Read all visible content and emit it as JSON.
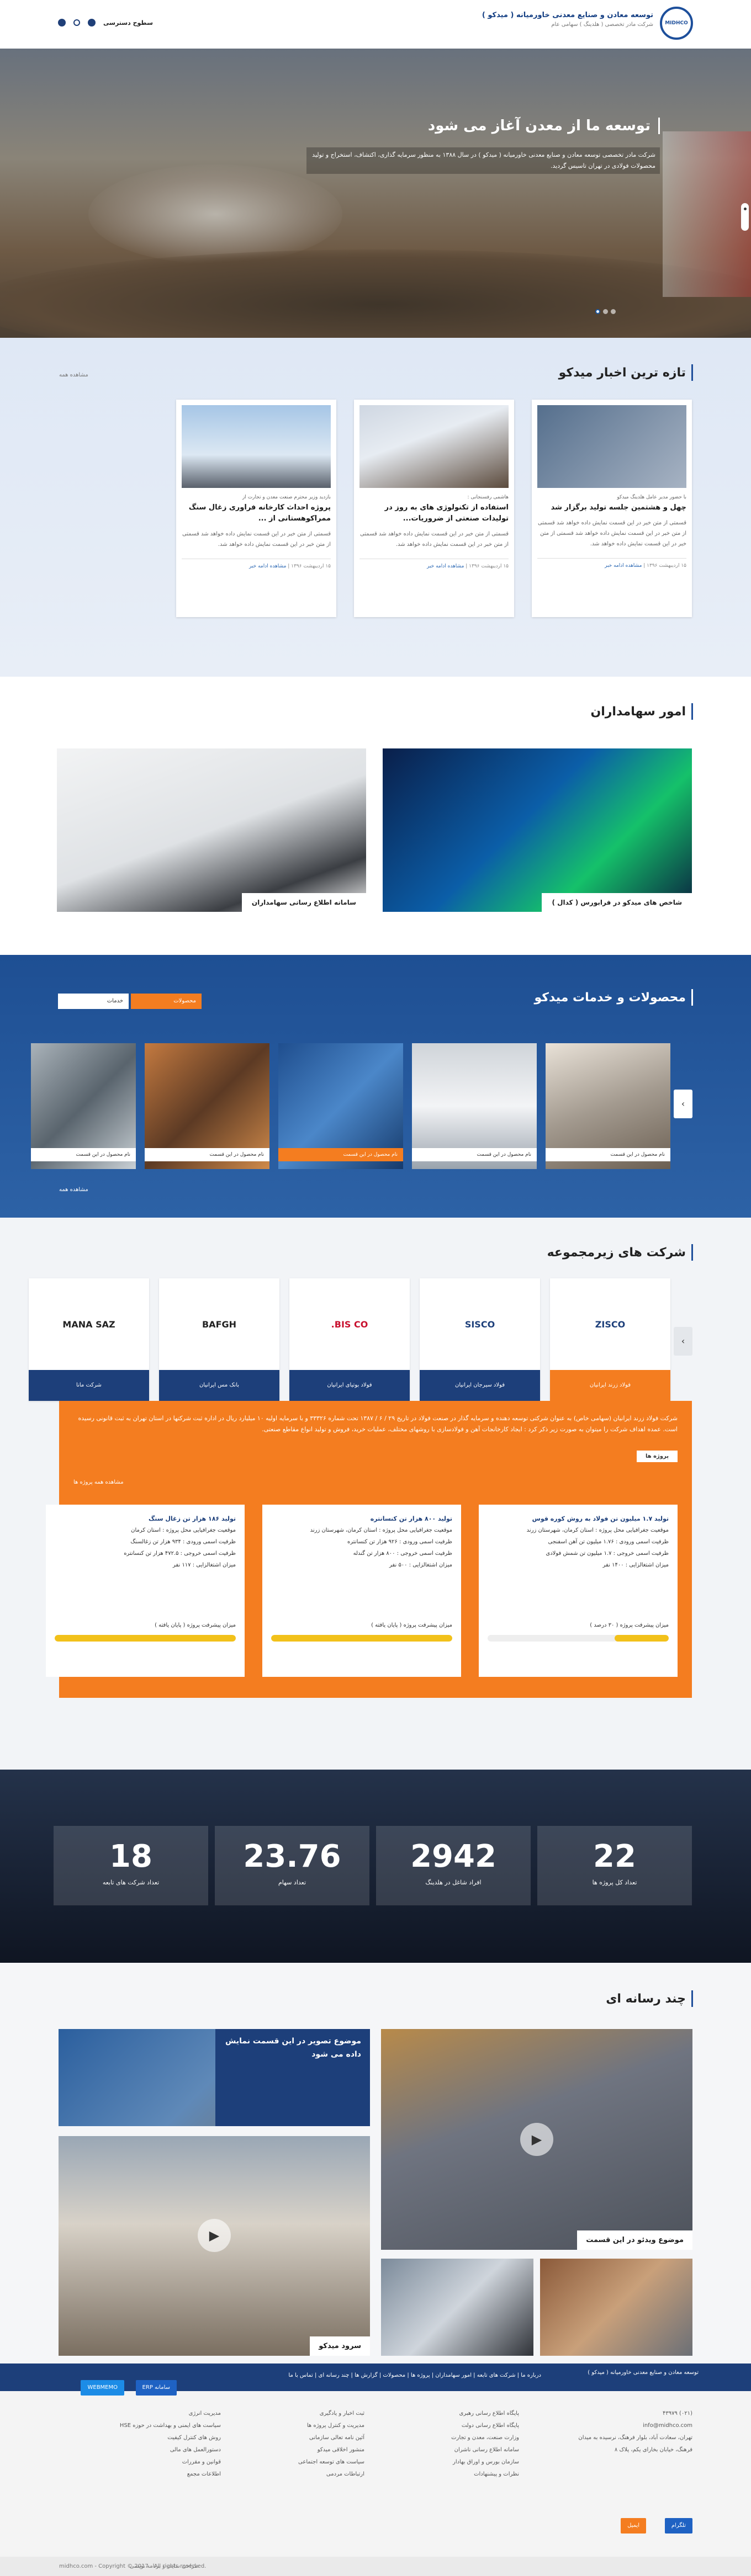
{
  "header": {
    "logo_text": "MIDHCO",
    "title": "توسعه معادن و صنایع معدنی خاورمیانه ( میدکو )",
    "subtitle": "شرکت مادر تخصصی ( هلدینگ ) سهامی عام",
    "access_level": "سطوح دسترسی",
    "icons": [
      "globe-icon",
      "search-icon",
      "user-icon"
    ]
  },
  "hero": {
    "title": "توسعه ما از معدن آغاز می شود",
    "text": "شرکت مادر تخصصی توسعه معادن و صنایع معدنی خاورمیانه ( میدکو ) در سال ۱۳۸۸ به منظور سرمایه گذاری، اکتشاف، استخراج و تولید محصولات فولادی در تهران تاسیس گردید."
  },
  "news": {
    "title": "تازه ترین اخبار میدکو",
    "more": "مشاهده همه",
    "items": [
      {
        "meta": "با حضور مدیر عامل هلدینگ میدکو",
        "title": "چهل و هشتمین جلسه تولید برگزار شد",
        "text": "قسمتی از متن خبر در این قسمت نمایش داده خواهد شد قسمتی از متن خبر در این قسمت نمایش داده خواهد شد قسمتی از متن خبر در این قسمت نمایش داده خواهد شد.",
        "date": "۱۵ اردیبهشت ۱۳۹۶",
        "more": "مشاهده ادامه خبر"
      },
      {
        "meta": "هاشمی رفسنجانی :",
        "title": "استفاده از تکنولوژی های به روز در تولیدات صنعتی از ضروریات...",
        "text": "قسمتی از متن خبر در این قسمت نمایش داده خواهد شد قسمتی از متن خبر در این قسمت نمایش داده خواهد شد.",
        "date": "۱۵ اردیبهشت ۱۳۹۶",
        "more": "مشاهده ادامه خبر"
      },
      {
        "meta": "بازدید وزیر محترم صنعت معدن و تجارت از",
        "title": "پروژه احداث کارخانه فراوری زغال سنگ ممراکوهستانی از ...",
        "text": "قسمتی از متن خبر در این قسمت نمایش داده خواهد شد قسمتی از متن خبر در این قسمت نمایش داده خواهد شد.",
        "date": "۱۵ اردیبهشت ۱۳۹۶",
        "more": "مشاهده ادامه خبر"
      }
    ]
  },
  "shareholders": {
    "title": "امور سهامداران",
    "cards": [
      "شاخص های میدکو در فرابورس ( کدال )",
      "سامانه اطلاع رسانی سهامداران"
    ]
  },
  "products": {
    "title": "محصولات و خدمات میدکو",
    "filter_1": "محصولات",
    "filter_2": "خدمات",
    "more": "مشاهده همه",
    "items": [
      "نام محصول در این قسمت",
      "نام محصول در این قسمت",
      "نام محصول در این قسمت",
      "نام محصول در این قسمت",
      "نام محصول در این قسمت"
    ]
  },
  "subsidiaries": {
    "title": "شرکت های زیرمجموعه",
    "companies": [
      {
        "logo": "ZISCO",
        "name": "فولاد زرند ایرانیان"
      },
      {
        "logo": "SISCO",
        "name": "فولاد سیرجان ایرانیان"
      },
      {
        "logo": "BIS CO.",
        "name": "فولاد بوتیای ایرانیان"
      },
      {
        "logo": "BAFGH",
        "name": "بانک مس ایرانیان"
      },
      {
        "logo": "MANA SAZ",
        "name": "شرکت مانا"
      }
    ],
    "description": "شرکت فولاد زرند ایرانیان (سهامی خاص) به عنوان شرکتی توسعه دهنده و سرمایه گذار در صنعت فولاد در تاریخ ۲۹ / ۶ / ۱۳۸۷ تحت شماره ۳۳۳۲۶ و با سرمایه اولیه ۱۰ میلیارد ریال در اداره ثبت شرکتها در استان تهران به ثبت قانونی رسیده است. عمده اهداف شرکت را میتوان به صورت زیر ذکر کرد : ایجاد کارخانجات آهن و فولادسازی با روشهای مختلف، عملیات خرید، فروش و تولید انواع مقاطع صنعتی.",
    "projects_label": "پروژه ها",
    "projects_more": "مشاهده همه پروژه ها",
    "projects": [
      {
        "title": "تولید ۱.۷ میلیون تن فولاد به روش کوره قوس",
        "lines": [
          "موقعیت جغرافیایی محل پروژه : استان کرمان، شهرستان زرند",
          "ظرفیت اسمی ورودی : ۱.۷۶ میلیون تن آهن اسفنجی",
          "ظرفیت اسمی خروجی : ۱.۷ میلیون تن شمش فولادی",
          "میزان اشتغالزایی : ۱۴۰۰ نفر"
        ],
        "progress_label": "میزان پیشرفت پروژه ( ۳۰ درصد )",
        "progress": 30
      },
      {
        "title": "تولید ۸۰۰ هزار تن کنسانتره",
        "lines": [
          "موقعیت جغرافیایی محل پروژه : استان کرمان، شهرستان زرند",
          "ظرفیت اسمی ورودی : ۹۲۶ هزار تن کنسانتره",
          "ظرفیت اسمی خروجی : ۸۰۰ هزار تن گندله",
          "میزان اشتغالزایی : ۵۰۰ نفر"
        ],
        "progress_label": "میزان پیشرفت پروژه ( پایان یافته )",
        "progress": 100
      },
      {
        "title": "تولید ۱۸۶ هزار تن زغال سنگ",
        "lines": [
          "موقعیت جغرافیایی محل پروژه : استان کرمان",
          "ظرفیت اسمی ورودی : ۹۳۴ هزار تن زغالسنگ",
          "ظرفیت اسمی خروجی : ۴۷۲.۵ هزار تن کنسانتره",
          "میزان اشتغالزایی : ۱۱۷ نفر"
        ],
        "progress_label": "میزان پیشرفت پروژه ( پایان یافته )",
        "progress": 100
      }
    ]
  },
  "stats": [
    {
      "value": "22",
      "label": "تعداد کل پروژه ها"
    },
    {
      "value": "2942",
      "label": "افراد شاغل در هلدینگ"
    },
    {
      "value": "23.76",
      "label": "تعداد سهام"
    },
    {
      "value": "18",
      "label": "تعداد شرکت های تابعه"
    }
  ],
  "media": {
    "title": "چند رسانه ای",
    "items": [
      {
        "caption": "موضوع ویدئو در این قسمت"
      },
      {
        "caption": "موضوع تصویر در این قسمت نمایش داده می شود"
      },
      {
        "caption": "سرود میدکو"
      }
    ]
  },
  "navstrip": {
    "brand": "توسعه معادن و صنایع معدنی خاورمیانه ( میدکو )",
    "links": "درباره ما | شرکت های تابعه | امور سهامداران | پروژه ها | محصولات | گزارش ها | چند رسانه ای | تماس با ما"
  },
  "footer": {
    "phone": "(۰۲۱) ۴۳۹۷۹",
    "email": "info@midhco.com",
    "address": "تهران، سعادت آباد، بلوار فرهنگ، نرسیده به میدان فرهنگ، خیابان بخارای یکم، پلاک ۸",
    "col1": [
      "پایگاه اطلاع رسانی رهبری",
      "پایگاه اطلاع رسانی دولت",
      "وزارت صنعت، معدن و تجارت",
      "سامانه اطلاع رسانی ناشران",
      "سازمان بورس و اوراق بهادار",
      "نظرات و پیشنهادات"
    ],
    "col2": [
      "ثبت اخبار و یادگیری",
      "مدیریت و کنترل پروژه ها",
      "آئین نامه تعالی سازمانی",
      "منشور اخلاقی میدکو",
      "سیاست های توسعه اجتماعی",
      "ارتباطات مردمی"
    ],
    "col3": [
      "مدیریت انرژی",
      "سیاست های ایمنی و بهداشت در حوزه HSE",
      "روش های کنترل کیفیت",
      "دستورالعمل های مالی",
      "قوانین و مقررات",
      "اطلاعات مجمع"
    ],
    "btn_erp": "سامانه ERP",
    "btn_web": "WEBMEMO",
    "btn_telegram": "تلگرام",
    "btn_email": "ایمیل",
    "copyright": "midhco.com - Copyright © 2017 - All rights reserved.",
    "credit": "طراحی سایت و برنامه نویسی"
  },
  "colors": {
    "brand_blue": "#1d3f7a",
    "accent_orange": "#f47d20",
    "progress_yellow": "#f2c11a"
  }
}
